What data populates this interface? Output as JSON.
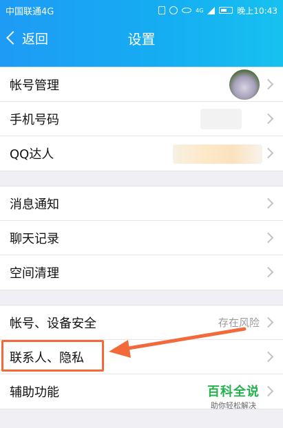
{
  "status": {
    "carrier": "中国联通4G",
    "network": "4G",
    "time": "晚上10:43"
  },
  "nav": {
    "back_label": "返回",
    "title": "设置"
  },
  "group1": [
    {
      "label": "帐号管理",
      "value": ""
    },
    {
      "label": "手机号码",
      "value": ""
    },
    {
      "label": "QQ达人",
      "value": ""
    }
  ],
  "group2": [
    {
      "label": "消息通知"
    },
    {
      "label": "聊天记录"
    },
    {
      "label": "空间清理"
    }
  ],
  "group3": [
    {
      "label": "帐号、设备安全",
      "value": "存在风险"
    },
    {
      "label": "联系人、隐私",
      "value": ""
    },
    {
      "label": "辅助功能",
      "value": ""
    }
  ],
  "watermark": {
    "title": "百科全说",
    "subtitle": "助你轻松解决"
  },
  "colors": {
    "nav_start": "#1e9bf5",
    "nav_end": "#17c1ef",
    "highlight": "#f26a3a",
    "watermark_green": "#22b14c"
  },
  "icons": [
    "vibrate-icon",
    "alarm-icon",
    "eye-icon",
    "signal-icon",
    "battery-icon",
    "back-chevron-icon",
    "chevron-right-icon"
  ]
}
